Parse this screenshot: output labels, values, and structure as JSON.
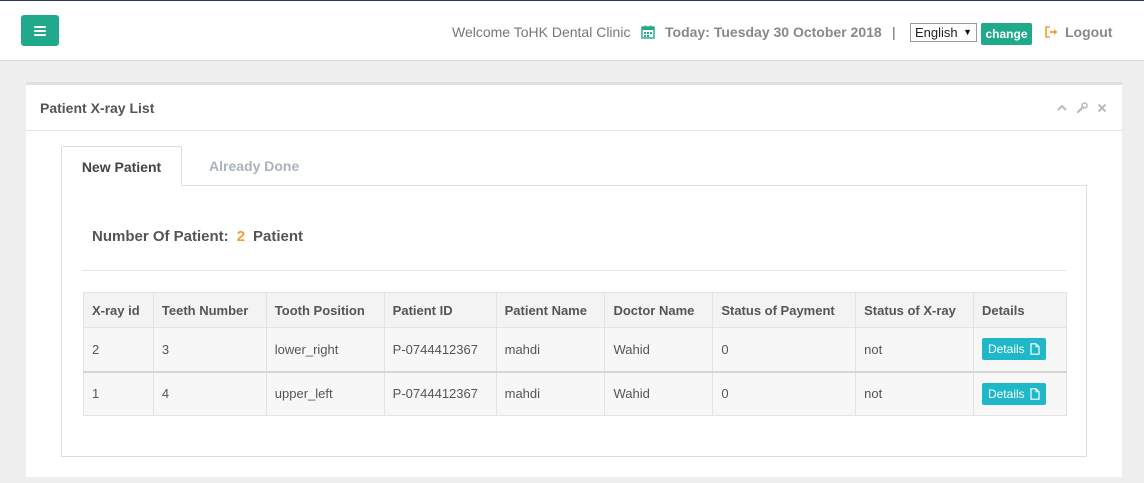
{
  "header": {
    "welcome": "Welcome ToHK Dental Clinic",
    "today_label": "Today:",
    "today_date": "Tuesday 30 October 2018",
    "separator": "|",
    "language_selected": "English",
    "change_label": "change",
    "logout_label": "Logout"
  },
  "panel": {
    "title": "Patient X-ray List"
  },
  "tabs": [
    {
      "label": "New Patient",
      "active": true
    },
    {
      "label": "Already Done",
      "active": false
    }
  ],
  "summary": {
    "label": "Number Of Patient:",
    "count": "2",
    "unit": "Patient"
  },
  "table": {
    "columns": [
      "X-ray id",
      "Teeth Number",
      "Tooth Position",
      "Patient ID",
      "Patient Name",
      "Doctor Name",
      "Status of Payment",
      "Status of X-ray",
      "Details"
    ],
    "rows": [
      {
        "xray_id": "2",
        "teeth_number": "3",
        "tooth_position": "lower_right",
        "patient_id": "P-0744412367",
        "patient_name": "mahdi",
        "doctor_name": "Wahid",
        "payment": "0",
        "xray_status": "not",
        "details_label": "Details"
      },
      {
        "xray_id": "1",
        "teeth_number": "4",
        "tooth_position": "upper_left",
        "patient_id": "P-0744412367",
        "patient_name": "mahdi",
        "doctor_name": "Wahid",
        "payment": "0",
        "xray_status": "not",
        "details_label": "Details"
      }
    ]
  },
  "colors": {
    "accent": "#20a98b",
    "details_button": "#1eb8c8",
    "count_highlight": "#f0a030"
  }
}
